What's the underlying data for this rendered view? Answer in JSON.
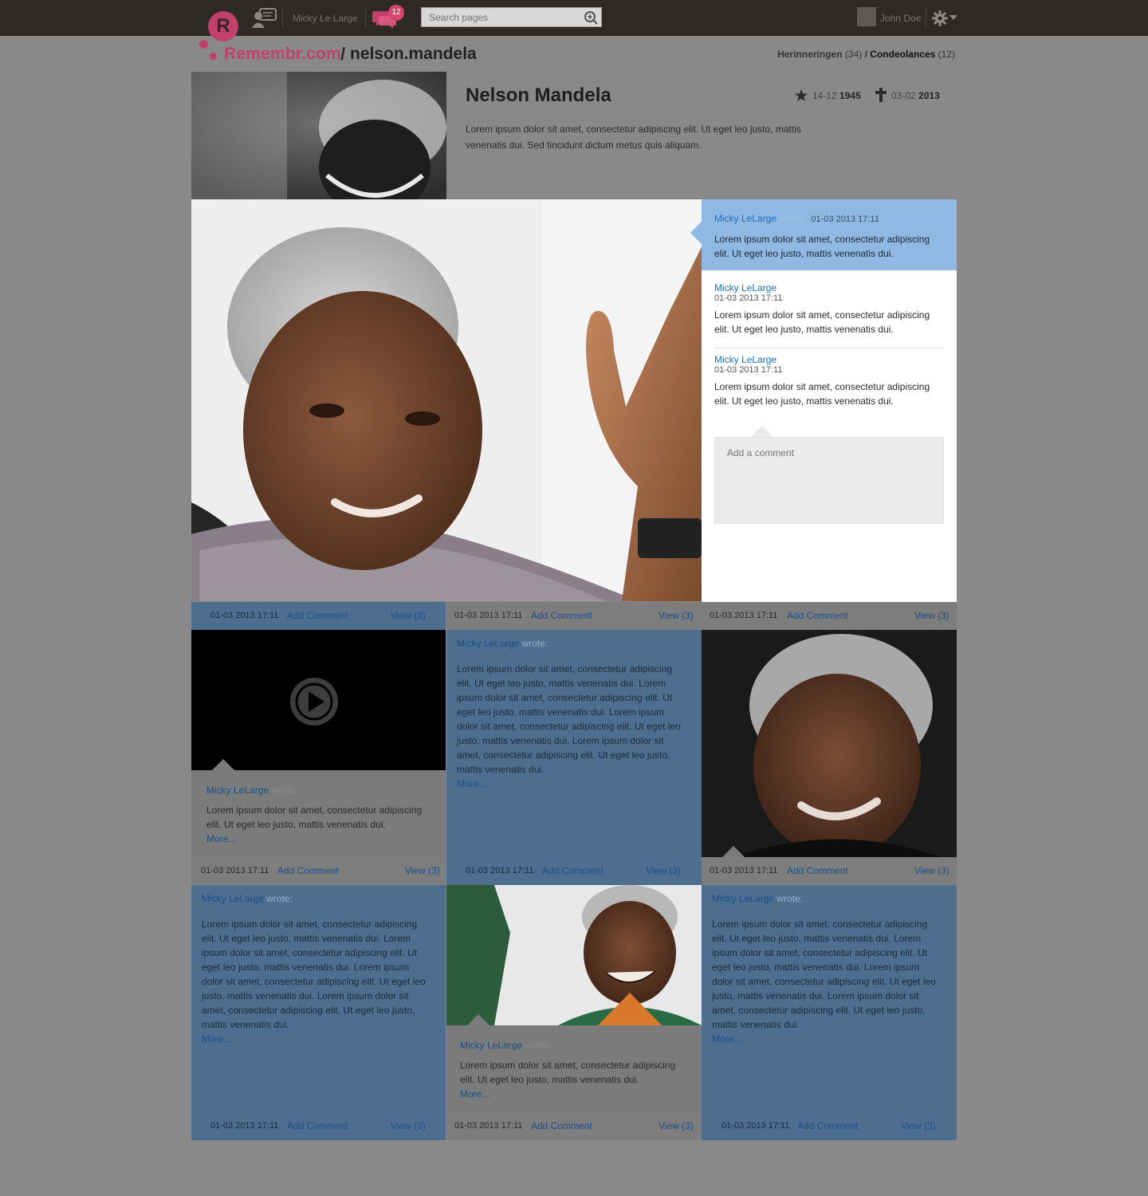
{
  "topbar": {
    "user_name": "Micky Le Large",
    "notification_count": "12",
    "search_placeholder": "Search pages",
    "account_name": "John Doe"
  },
  "brand": {
    "logo_letter": "R",
    "logo_text": "Remembr.com",
    "slash": "/",
    "page_slug": "nelson.mandela"
  },
  "nav": {
    "memories_label": "Herinneringen",
    "memories_count": "(34)",
    "separator": "/",
    "condolences_label": "Condeolances",
    "condolences_count": "(12)"
  },
  "profile": {
    "name": "Nelson Mandela",
    "born_daymonth": "14-12",
    "born_year": "1945",
    "died_daymonth": "03-02",
    "died_year": "2013",
    "bio": "Lorem ipsum dolor sit amet, consectetur adipiscing elit. Ut eget leo justo, mattis venenatis dui. Sed tincidunt dictum metus quis aliquam."
  },
  "comments": [
    {
      "author": "Micky LeLarge",
      "wrote": "wrote:",
      "time": "01-03 2013 17:11",
      "text": "Lorem ipsum dolor sit amet, consectetur adipiscing elit. Ut eget leo justo, mattis venenatis dui."
    },
    {
      "author": "Micky LeLarge",
      "time": "01-03 2013 17:11",
      "text": "Lorem ipsum dolor sit amet, consectetur adipiscing elit. Ut eget leo justo, mattis venenatis dui."
    },
    {
      "author": "Micky LeLarge",
      "time": "01-03 2013 17:11",
      "text": "Lorem ipsum dolor sit amet, consectetur adipiscing elit. Ut eget leo justo, mattis venenatis dui."
    }
  ],
  "add_comment_placeholder": "Add a comment",
  "meta": {
    "time": "01-03 2013 17:11",
    "add_label": "Add Comment",
    "view_label": "View (3)"
  },
  "posts": {
    "author": "Micky LeLarge",
    "wrote": "wrote:",
    "short_text": "Lorem ipsum dolor sit amet, consectetur adipiscing elit. Ut eget leo justo, mattis venenatis dui.",
    "long_text": "Lorem ipsum dolor sit amet, consectetur adipiscing elit. Ut eget leo justo, mattis venenatis dui.  Lorem ipsum dolor sit amet, consectetur adipiscing elit. Ut eget leo justo, mattis venenatis dui. Lorem ipsum dolor sit amet, consectetur adipiscing elit. Ut eget leo justo, mattis venenatis dui. Lorem ipsum dolor sit amet, consectetur adipiscing elit. Ut eget leo justo, mattis venenatis dui.",
    "more": "More..."
  },
  "colors": {
    "brand": "#c2406c",
    "link": "#1d6fbf",
    "topbar": "#2d2926",
    "highlight": "#8fb8e3"
  }
}
